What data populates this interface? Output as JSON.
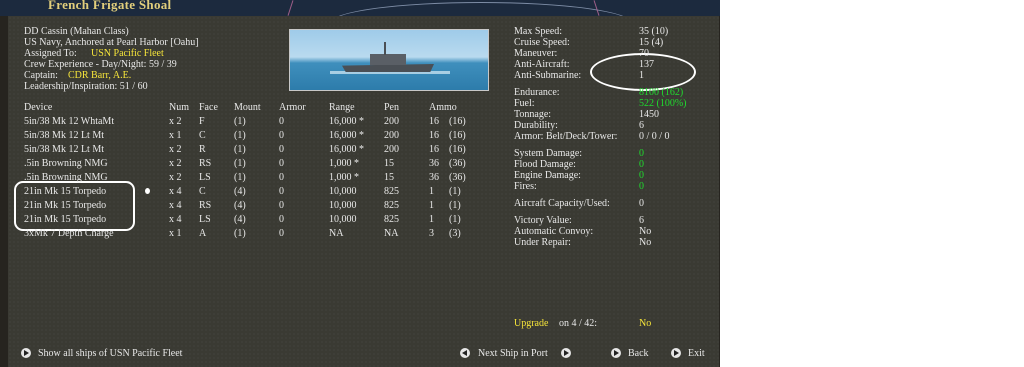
{
  "location": "French Frigate Shoal",
  "ship": {
    "name": "DD Cassin (Mahan Class)",
    "status": "US Navy, Anchored at Pearl Harbor [Oahu]",
    "assigned_label": "Assigned To:",
    "assigned_value": "USN Pacific Fleet",
    "crew_exp": "Crew Experience - Day/Night:  59 / 39",
    "captain_label": "Captain:",
    "captain_value": "CDR Barr, A.E.",
    "leadership": "Leadership/Inspiration: 51 / 60"
  },
  "devices": {
    "headers": [
      "Device",
      "Num",
      "Face",
      "Mount",
      "Armor",
      "Range",
      "Pen",
      "Ammo"
    ],
    "rows": [
      [
        "5in/38 Mk 12 WhtaMt",
        "x 2",
        "F",
        "(1)",
        "0",
        "16,000 *",
        "200",
        "16",
        "(16)"
      ],
      [
        "5in/38 Mk 12 Lt Mt",
        "x 1",
        "C",
        "(1)",
        "0",
        "16,000 *",
        "200",
        "16",
        "(16)"
      ],
      [
        "5in/38 Mk 12 Lt Mt",
        "x 2",
        "R",
        "(1)",
        "0",
        "16,000 *",
        "200",
        "16",
        "(16)"
      ],
      [
        ".5in Browning NMG",
        "x 2",
        "RS",
        "(1)",
        "0",
        "1,000 *",
        "15",
        "36",
        "(36)"
      ],
      [
        ".5in Browning NMG",
        "x 2",
        "LS",
        "(1)",
        "0",
        "1,000 *",
        "15",
        "36",
        "(36)"
      ],
      [
        "21in Mk 15 Torpedo",
        "x 4",
        "C",
        "(4)",
        "0",
        "10,000",
        "825",
        "1",
        "(1)"
      ],
      [
        "21in Mk 15 Torpedo",
        "x 4",
        "RS",
        "(4)",
        "0",
        "10,000",
        "825",
        "1",
        "(1)"
      ],
      [
        "21in Mk 15 Torpedo",
        "x 4",
        "LS",
        "(4)",
        "0",
        "10,000",
        "825",
        "1",
        "(1)"
      ],
      [
        "3xMk 7 Depth Charge",
        "x 1",
        "A",
        "(1)",
        "0",
        "NA",
        "NA",
        "3",
        "(3)"
      ]
    ]
  },
  "stats": [
    {
      "label": "Max Speed:",
      "value": "35 (10)",
      "color": "#e8e8e8"
    },
    {
      "label": "Cruise Speed:",
      "value": "15 (4)",
      "color": "#e8e8e8"
    },
    {
      "label": "Maneuver:",
      "value": "70",
      "color": "#e8e8e8"
    },
    {
      "label": "Anti-Aircraft:",
      "value": "137",
      "color": "#e8e8e8"
    },
    {
      "label": "Anti-Submarine:",
      "value": "1",
      "color": "#e8e8e8"
    },
    {
      "label": "Endurance:",
      "value": "8100 (162)",
      "color": "#1fdc2e"
    },
    {
      "label": "Fuel:",
      "value": "522 (100%)",
      "color": "#1fdc2e"
    },
    {
      "label": "Tonnage:",
      "value": "1450",
      "color": "#e8e8e8"
    },
    {
      "label": "Durability:",
      "value": "6",
      "color": "#e8e8e8"
    },
    {
      "label": "Armor: Belt/Deck/Tower:",
      "value": "0 / 0 / 0",
      "color": "#e8e8e8"
    },
    {
      "label": "System Damage:",
      "value": "0",
      "color": "#1fdc2e"
    },
    {
      "label": "Flood Damage:",
      "value": "0",
      "color": "#1fdc2e"
    },
    {
      "label": "Engine Damage:",
      "value": "0",
      "color": "#1fdc2e"
    },
    {
      "label": "Fires:",
      "value": "0",
      "color": "#1fdc2e"
    },
    {
      "label": "Aircraft Capacity/Used:",
      "value": "0",
      "color": "#e8e8e8"
    },
    {
      "label": "Victory Value:",
      "value": "6",
      "color": "#e8e8e8"
    },
    {
      "label": "Automatic Convoy:",
      "value": "No",
      "color": "#e8e8e8"
    },
    {
      "label": "Under Repair:",
      "value": "No",
      "color": "#e8e8e8"
    }
  ],
  "upgrade": {
    "label": "Upgrade",
    "on_text": "on  4 / 42:",
    "value": "No"
  },
  "buttons": {
    "show_all": "Show all ships of USN Pacific Fleet",
    "next_ship": "Next Ship in Port",
    "back": "Back",
    "exit": "Exit"
  },
  "colors": {
    "highlight": "#f6e53a",
    "good": "#1fdc2e",
    "text": "#e8e8e8",
    "panel": "#3a3a33"
  },
  "icons": [
    "left-arrow-icon",
    "right-arrow-icon",
    "ship-photo"
  ]
}
